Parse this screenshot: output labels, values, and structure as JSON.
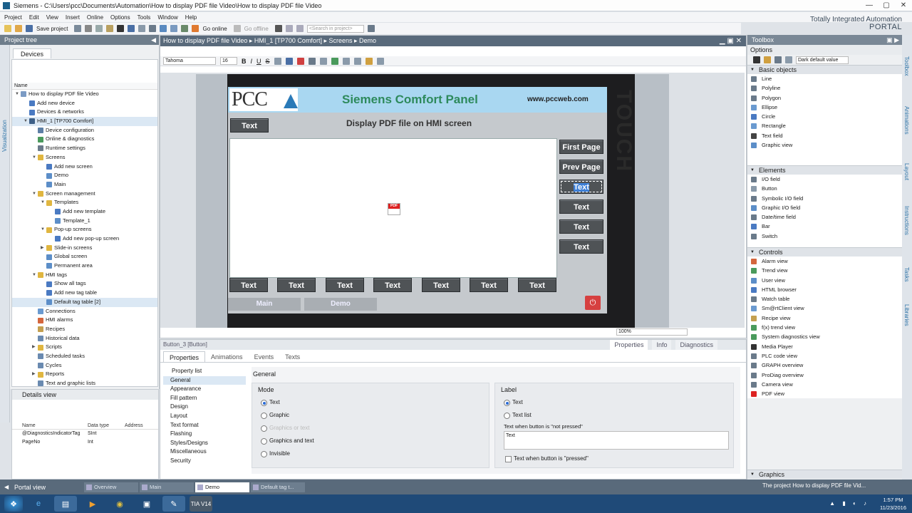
{
  "window": {
    "title": "Siemens  -  C:\\Users\\pcc\\Documents\\Automation\\How to display PDF file Video\\How to display PDF file Video",
    "minimize": "—",
    "maximize": "▢",
    "close": "✕"
  },
  "menu": [
    "Project",
    "Edit",
    "View",
    "Insert",
    "Online",
    "Options",
    "Tools",
    "Window",
    "Help"
  ],
  "brand": {
    "line1": "Totally Integrated Automation",
    "line2": "PORTAL"
  },
  "toolbar": {
    "save": "Save project",
    "go_online": "Go online",
    "go_offline": "Go offline",
    "search_placeholder": "<Search in project>"
  },
  "project_tree": {
    "title": "Project tree",
    "tab": "Devices",
    "side_label": "Visualization",
    "column": "Name",
    "items": [
      {
        "label": "How to display PDF file Video",
        "level": 0,
        "arrow": "▼",
        "color": "#7b9bc4"
      },
      {
        "label": "Add new device",
        "level": 1,
        "arrow": "",
        "color": "#4a7ac2"
      },
      {
        "label": "Devices & networks",
        "level": 1,
        "arrow": "",
        "color": "#4a7ac2"
      },
      {
        "label": "HMI_1 [TP700 Comfort]",
        "level": 1,
        "arrow": "▼",
        "color": "#3d5f87",
        "sel": true
      },
      {
        "label": "Device configuration",
        "level": 2,
        "arrow": "",
        "color": "#5d7fa5"
      },
      {
        "label": "Online & diagnostics",
        "level": 2,
        "arrow": "",
        "color": "#4a9a5c"
      },
      {
        "label": "Runtime settings",
        "level": 2,
        "arrow": "",
        "color": "#6a7a8a"
      },
      {
        "label": "Screens",
        "level": 2,
        "arrow": "▼",
        "color": "#e0b640"
      },
      {
        "label": "Add new screen",
        "level": 3,
        "arrow": "",
        "color": "#4a7ac2"
      },
      {
        "label": "Demo",
        "level": 3,
        "arrow": "",
        "color": "#5c8ec8"
      },
      {
        "label": "Main",
        "level": 3,
        "arrow": "",
        "color": "#5c8ec8"
      },
      {
        "label": "Screen management",
        "level": 2,
        "arrow": "▼",
        "color": "#e0b640"
      },
      {
        "label": "Templates",
        "level": 3,
        "arrow": "▼",
        "color": "#e0b640"
      },
      {
        "label": "Add new template",
        "level": 4,
        "arrow": "",
        "color": "#4a7ac2"
      },
      {
        "label": "Template_1",
        "level": 4,
        "arrow": "",
        "color": "#5c8ec8"
      },
      {
        "label": "Pop-up screens",
        "level": 3,
        "arrow": "▼",
        "color": "#e0b640"
      },
      {
        "label": "Add new pop-up screen",
        "level": 4,
        "arrow": "",
        "color": "#4a7ac2"
      },
      {
        "label": "Slide-in screens",
        "level": 3,
        "arrow": "▶",
        "color": "#e0b640"
      },
      {
        "label": "Global screen",
        "level": 3,
        "arrow": "",
        "color": "#5c8ec8"
      },
      {
        "label": "Permanent area",
        "level": 3,
        "arrow": "",
        "color": "#5c8ec8"
      },
      {
        "label": "HMI tags",
        "level": 2,
        "arrow": "▼",
        "color": "#e0b640"
      },
      {
        "label": "Show all tags",
        "level": 3,
        "arrow": "",
        "color": "#4a7ac2"
      },
      {
        "label": "Add new tag table",
        "level": 3,
        "arrow": "",
        "color": "#4a7ac2"
      },
      {
        "label": "Default tag table [2]",
        "level": 3,
        "arrow": "",
        "color": "#5c8ec8",
        "sel": true
      },
      {
        "label": "Connections",
        "level": 2,
        "arrow": "",
        "color": "#6a9ad0"
      },
      {
        "label": "HMI alarms",
        "level": 2,
        "arrow": "",
        "color": "#d4663d"
      },
      {
        "label": "Recipes",
        "level": 2,
        "arrow": "",
        "color": "#c4a050"
      },
      {
        "label": "Historical data",
        "level": 2,
        "arrow": "",
        "color": "#6a8ab0"
      },
      {
        "label": "Scripts",
        "level": 2,
        "arrow": "▶",
        "color": "#e0b640"
      },
      {
        "label": "Scheduled tasks",
        "level": 2,
        "arrow": "",
        "color": "#6a8ab0"
      },
      {
        "label": "Cycles",
        "level": 2,
        "arrow": "",
        "color": "#6a8ab0"
      },
      {
        "label": "Reports",
        "level": 2,
        "arrow": "▶",
        "color": "#e0b640"
      },
      {
        "label": "Text and graphic lists",
        "level": 2,
        "arrow": "",
        "color": "#6a8ab0"
      }
    ]
  },
  "details": {
    "title": "Details view",
    "columns": [
      "Name",
      "Data type",
      "Address"
    ],
    "rows": [
      {
        "name": "@DiagnosticsIndicatorTag",
        "type": "SInt",
        "address": ""
      },
      {
        "name": "PageNo",
        "type": "Int",
        "address": ""
      }
    ]
  },
  "editor": {
    "breadcrumb": "How to display PDF file Video  ▸  HMI_1 [TP700 Comfort]  ▸  Screens  ▸  Demo",
    "font": "Tahoma",
    "font_size": "16",
    "zoom": "100%",
    "hmi": {
      "logo": "PCC",
      "title": "Siemens Comfort Panel",
      "url": "www.pccweb.com",
      "subtitle": "Display PDF file on HMI screen",
      "touch": "TOUCH",
      "top_button": "Text",
      "pdf_icon": "PDF",
      "right_buttons": [
        "First Page",
        "Prev Page",
        "Text",
        "Text",
        "Text",
        "Text"
      ],
      "bottom_buttons": [
        "Text",
        "Text",
        "Text",
        "Text",
        "Text",
        "Text",
        "Text"
      ],
      "nav_buttons": [
        "Main",
        "Demo"
      ]
    }
  },
  "inspector": {
    "header": "Button_3 [Button]",
    "right_tabs": [
      "Properties",
      "Info",
      "Diagnostics"
    ],
    "tabs": [
      "Properties",
      "Animations",
      "Events",
      "Texts"
    ],
    "property_list_title": "Property list",
    "property_list": [
      "General",
      "Appearance",
      "Fill pattern",
      "Design",
      "Layout",
      "Text format",
      "Flashing",
      "Styles/Designs",
      "Miscellaneous",
      "Security"
    ],
    "section": "General",
    "mode": {
      "title": "Mode",
      "options": [
        "Text",
        "Graphic",
        "Graphics or text",
        "Graphics and text",
        "Invisible"
      ]
    },
    "label": {
      "title": "Label",
      "options": [
        "Text",
        "Text list"
      ],
      "not_pressed_label": "Text when button is \"not pressed\"",
      "not_pressed_value": "Text",
      "pressed_label": "Text when button is \"pressed\""
    }
  },
  "toolbox": {
    "title": "Toolbox",
    "options": "Options",
    "style": "Dark default value",
    "sections": [
      {
        "title": "Basic objects",
        "items": [
          {
            "label": "Line",
            "color": "#6a7a8a"
          },
          {
            "label": "Polyline",
            "color": "#6a7a8a"
          },
          {
            "label": "Polygon",
            "color": "#6a7a8a"
          },
          {
            "label": "Ellipse",
            "color": "#6a9ad0"
          },
          {
            "label": "Circle",
            "color": "#4a7ac2"
          },
          {
            "label": "Rectangle",
            "color": "#6a9ad0"
          },
          {
            "label": "Text field",
            "color": "#444"
          },
          {
            "label": "Graphic view",
            "color": "#5c8ec8"
          }
        ]
      },
      {
        "title": "Elements",
        "items": [
          {
            "label": "I/O field",
            "color": "#6a7a8a"
          },
          {
            "label": "Button",
            "color": "#8a9aaa"
          },
          {
            "label": "Symbolic I/O field",
            "color": "#6a7a8a"
          },
          {
            "label": "Graphic I/O field",
            "color": "#5c8ec8"
          },
          {
            "label": "Date/time field",
            "color": "#6a7a8a"
          },
          {
            "label": "Bar",
            "color": "#4a7ac2"
          },
          {
            "label": "Switch",
            "color": "#6a7a8a"
          }
        ]
      },
      {
        "title": "Controls",
        "items": [
          {
            "label": "Alarm view",
            "color": "#d4663d"
          },
          {
            "label": "Trend view",
            "color": "#4a9a5c"
          },
          {
            "label": "User view",
            "color": "#5c8ec8"
          },
          {
            "label": "HTML browser",
            "color": "#4a7ac2"
          },
          {
            "label": "Watch table",
            "color": "#6a7a8a"
          },
          {
            "label": "Sm@rtClient view",
            "color": "#6a9ad0"
          },
          {
            "label": "Recipe view",
            "color": "#c4a050"
          },
          {
            "label": "f(x) trend view",
            "color": "#4a9a5c"
          },
          {
            "label": "System diagnostics view",
            "color": "#4a9a5c"
          },
          {
            "label": "Media Player",
            "color": "#333"
          },
          {
            "label": "PLC code view",
            "color": "#6a7a8a"
          },
          {
            "label": "GRAPH overview",
            "color": "#6a7a8a"
          },
          {
            "label": "ProDiag overview",
            "color": "#6a7a8a"
          },
          {
            "label": "Camera view",
            "color": "#6a7a8a"
          },
          {
            "label": "PDF view",
            "color": "#d22"
          }
        ]
      }
    ],
    "graphics": "Graphics",
    "side_tabs": [
      "Toolbox",
      "Animations",
      "Layout",
      "Instructions",
      "Tasks",
      "Libraries"
    ]
  },
  "statusbar": {
    "portal_view": "Portal view",
    "tabs": [
      "Overview",
      "Main",
      "Demo",
      "Default tag t..."
    ],
    "active_tab": 2,
    "message": "The project How to display PDF file Vid..."
  },
  "taskbar": {
    "time": "1:57 PM",
    "date": "11/23/2016",
    "tia": "TIA V14"
  }
}
